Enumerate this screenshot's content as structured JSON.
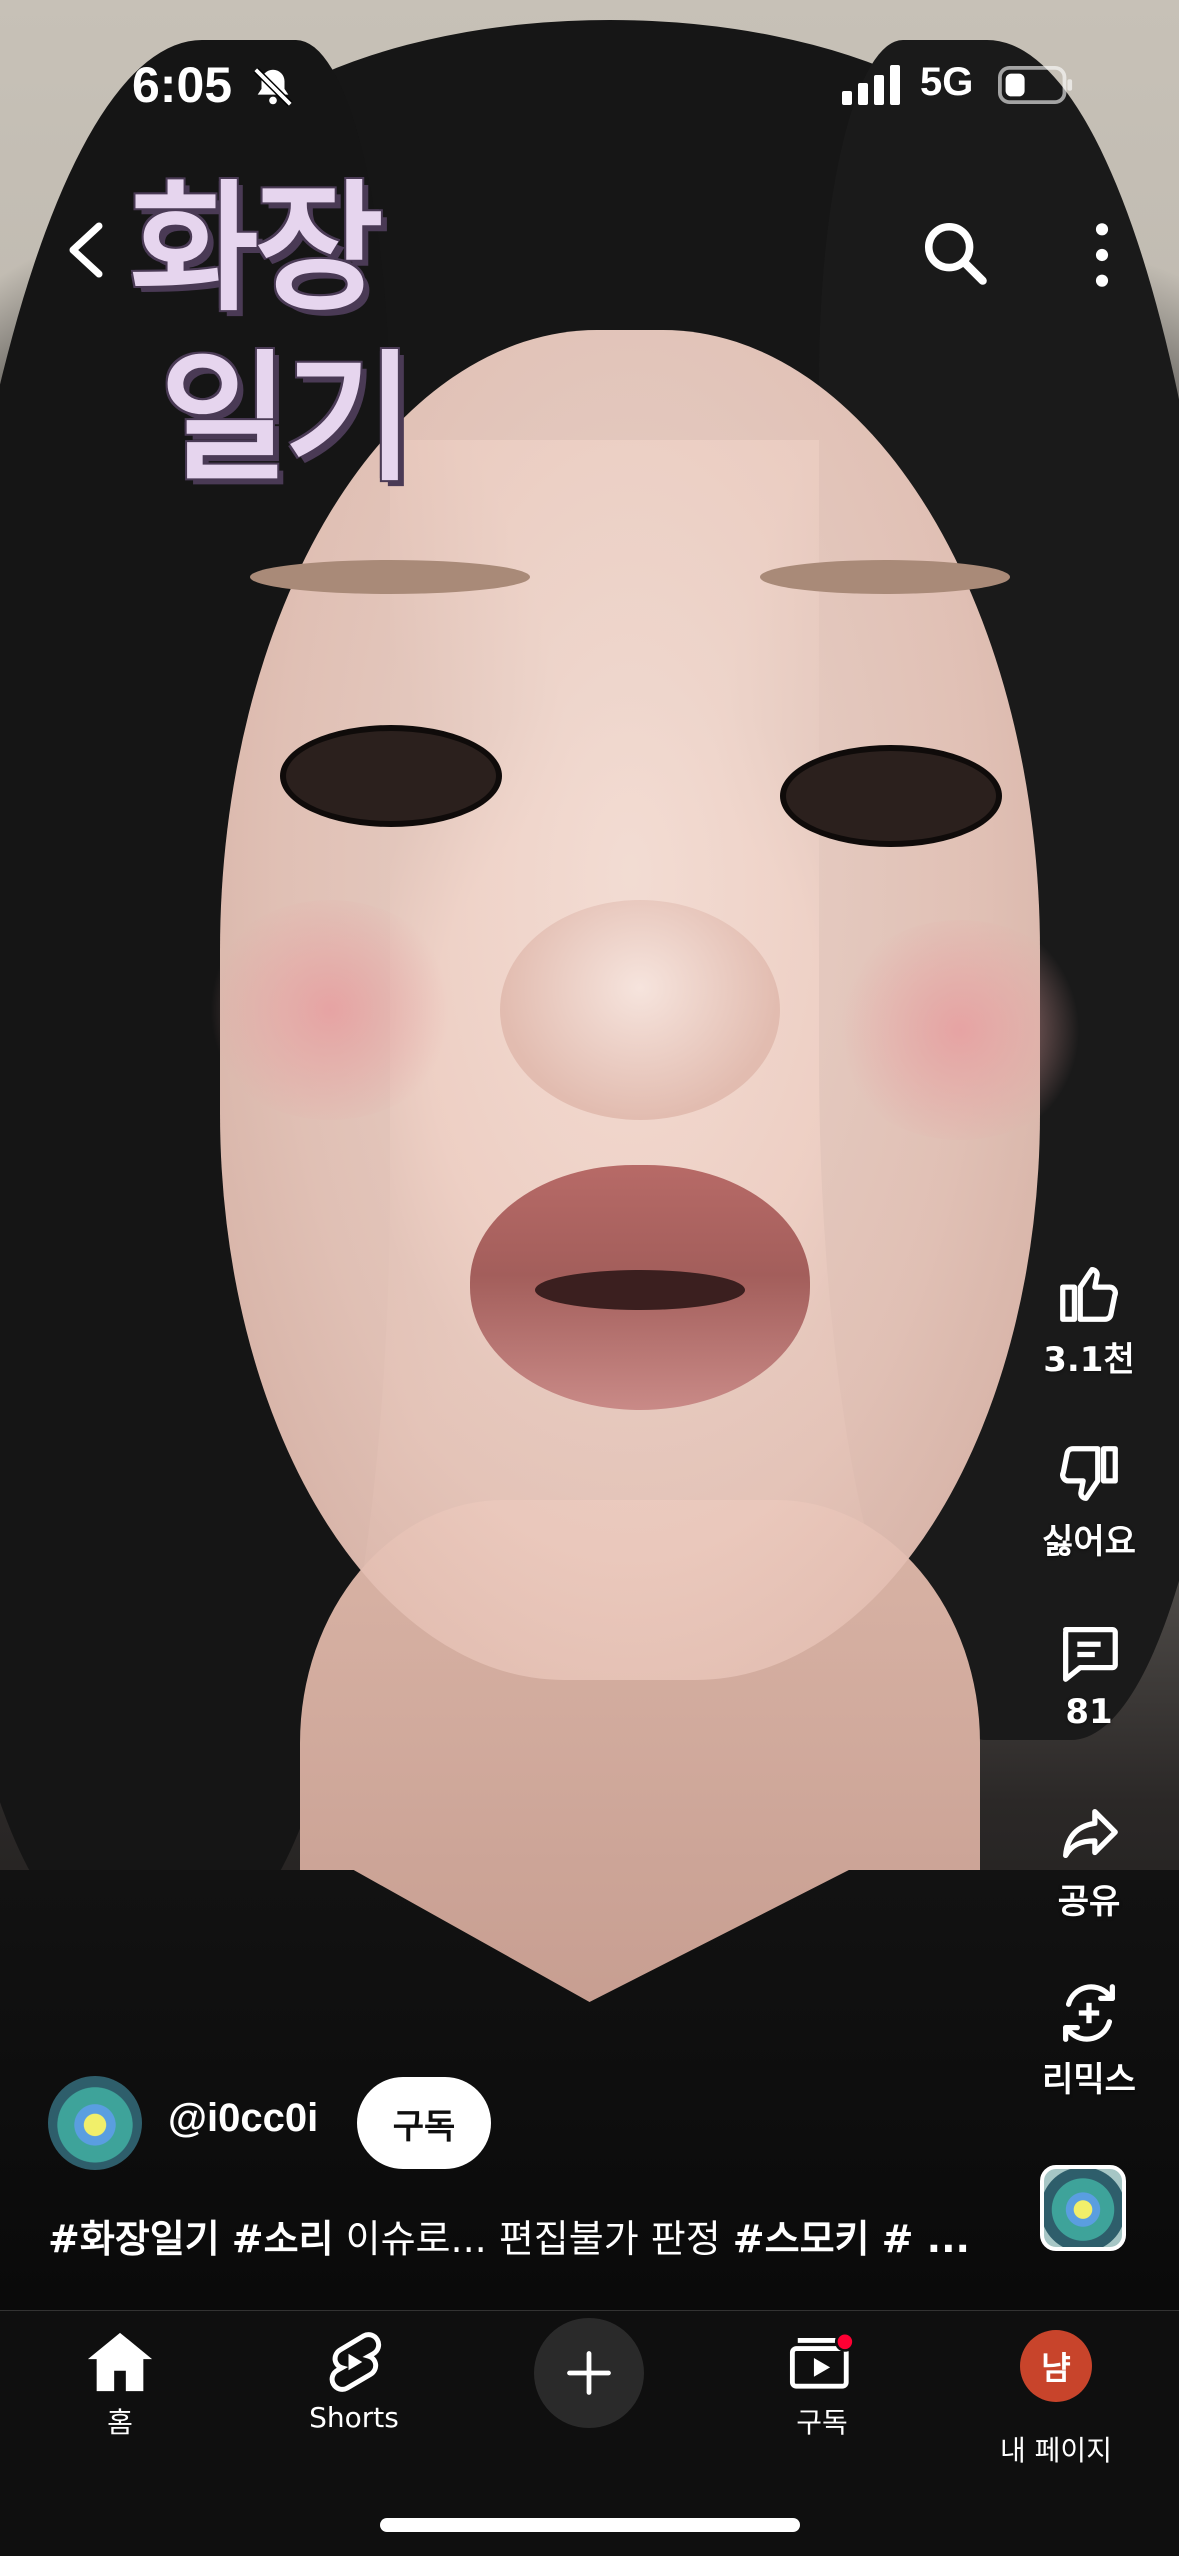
{
  "status_bar": {
    "time": "6:05",
    "network": "5G"
  },
  "overlay": {
    "title_line1": "화장",
    "title_line2": "일기"
  },
  "actions": {
    "like_count": "3.1천",
    "dislike_label": "싫어요",
    "comment_count": "81",
    "share_label": "공유",
    "remix_label": "리믹스"
  },
  "channel": {
    "handle": "@i0cc0i",
    "subscribe_label": "구독"
  },
  "caption": {
    "tag1": "#화장일기",
    "tag2": "#소리",
    "text": "이슈로... 편집불가 판정",
    "tag3": "#스모키",
    "tail": "# ..."
  },
  "bottom_nav": {
    "home": "홈",
    "shorts": "Shorts",
    "subscriptions": "구독",
    "me": "내 페이지",
    "me_avatar_letter": "냠"
  },
  "colors": {
    "accent_red": "#ff0033",
    "nav_bg": "#0f0f0f",
    "avatar_bg": "#c8442b",
    "title_purple": "#e6d5ee"
  },
  "icons": [
    "bell-muted-icon",
    "signal-icon",
    "battery-icon",
    "back-icon",
    "search-icon",
    "more-vertical-icon",
    "like-icon",
    "dislike-icon",
    "comment-icon",
    "share-icon",
    "remix-icon",
    "home-icon",
    "shorts-icon",
    "create-icon",
    "subscriptions-icon"
  ]
}
